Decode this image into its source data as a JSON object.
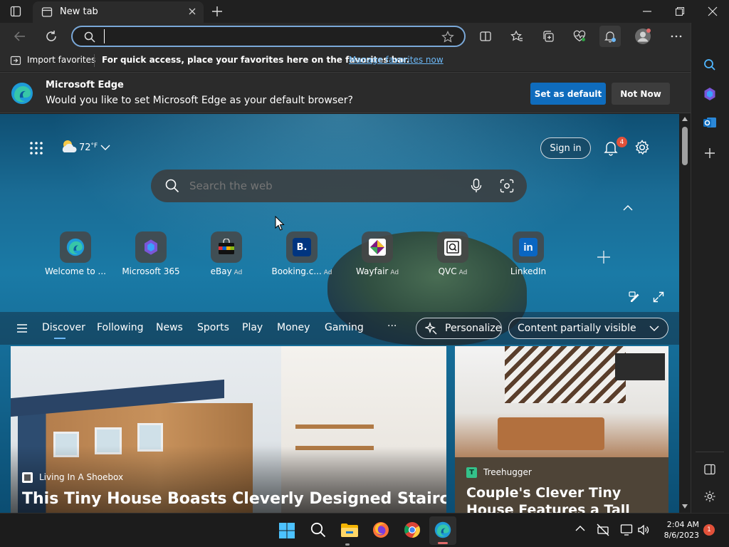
{
  "tab": {
    "title": "New tab"
  },
  "address_bar": {
    "value": "",
    "placeholder": ""
  },
  "favorites_bar": {
    "import_label": "Import favorites",
    "prompt": "For quick access, place your favorites here on the favorites bar.",
    "manage_link": "Manage favorites now"
  },
  "infobar": {
    "title": "Microsoft Edge",
    "message": "Would you like to set Microsoft Edge as your default browser?",
    "set_default": "Set as default",
    "not_now": "Not Now"
  },
  "newtab": {
    "weather": {
      "temp": "72",
      "unit": "°F"
    },
    "sign_in": "Sign in",
    "notification_count": "4",
    "search_placeholder": "Search the web",
    "quick_links": [
      {
        "label": "Welcome to ...",
        "ad": ""
      },
      {
        "label": "Microsoft 365",
        "ad": ""
      },
      {
        "label": "eBay",
        "ad": "Ad"
      },
      {
        "label": "Booking.c...",
        "ad": "Ad"
      },
      {
        "label": "Wayfair",
        "ad": "Ad"
      },
      {
        "label": "QVC",
        "ad": "Ad"
      },
      {
        "label": "LinkedIn",
        "ad": ""
      }
    ],
    "feed_tabs": [
      "Discover",
      "Following",
      "News",
      "Sports",
      "Play",
      "Money",
      "Gaming"
    ],
    "more": "···",
    "personalize": "Personalize",
    "content_visibility": "Content partially visible"
  },
  "cards": [
    {
      "source": "Living In A Shoebox",
      "title": "This Tiny House Boasts Cleverly Designed Staircase"
    },
    {
      "source": "Treehugger",
      "title": "Couple's Clever Tiny House Features a Tall Shower and"
    }
  ],
  "taskbar": {
    "time": "2:04 AM",
    "date": "8/6/2023",
    "notifications": "1"
  },
  "colors": {
    "accent": "#0f6cbd",
    "link": "#6cb8f6",
    "badge": "#e2513a"
  }
}
